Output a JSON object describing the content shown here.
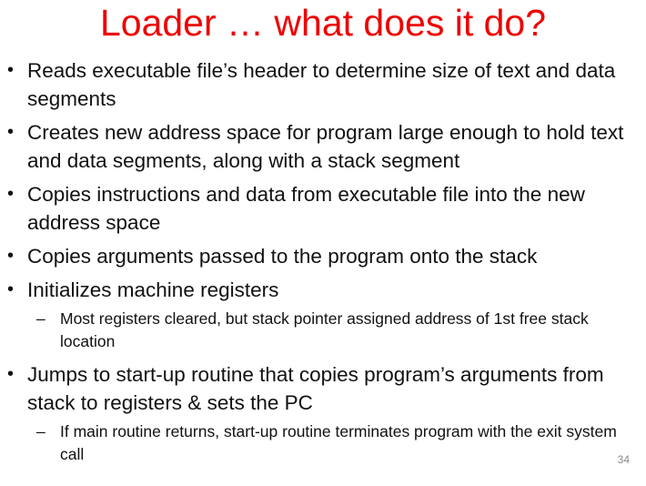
{
  "slide": {
    "title": "Loader … what does it do?",
    "bullet_glyph": "•",
    "dash_glyph": "–",
    "items": [
      {
        "text": "Reads executable file’s header to determine size of text and data segments"
      },
      {
        "text": "Creates new address space for program large enough to hold text and data segments, along with a stack segment"
      },
      {
        "text": "Copies instructions and data from executable file into the new address space"
      },
      {
        "text": "Copies arguments passed to the program onto the stack"
      },
      {
        "text": "Initializes machine registers",
        "sub": "Most registers cleared, but stack pointer assigned address of 1st free stack location"
      },
      {
        "text": "Jumps to start-up routine that copies program’s arguments from stack to registers & sets the PC",
        "sub": "If main routine returns, start-up routine terminates program with the exit system call"
      }
    ],
    "page_number": "34",
    "colors": {
      "title": "#ee0000",
      "text": "#111111",
      "page_number": "#8a8a8a"
    }
  }
}
